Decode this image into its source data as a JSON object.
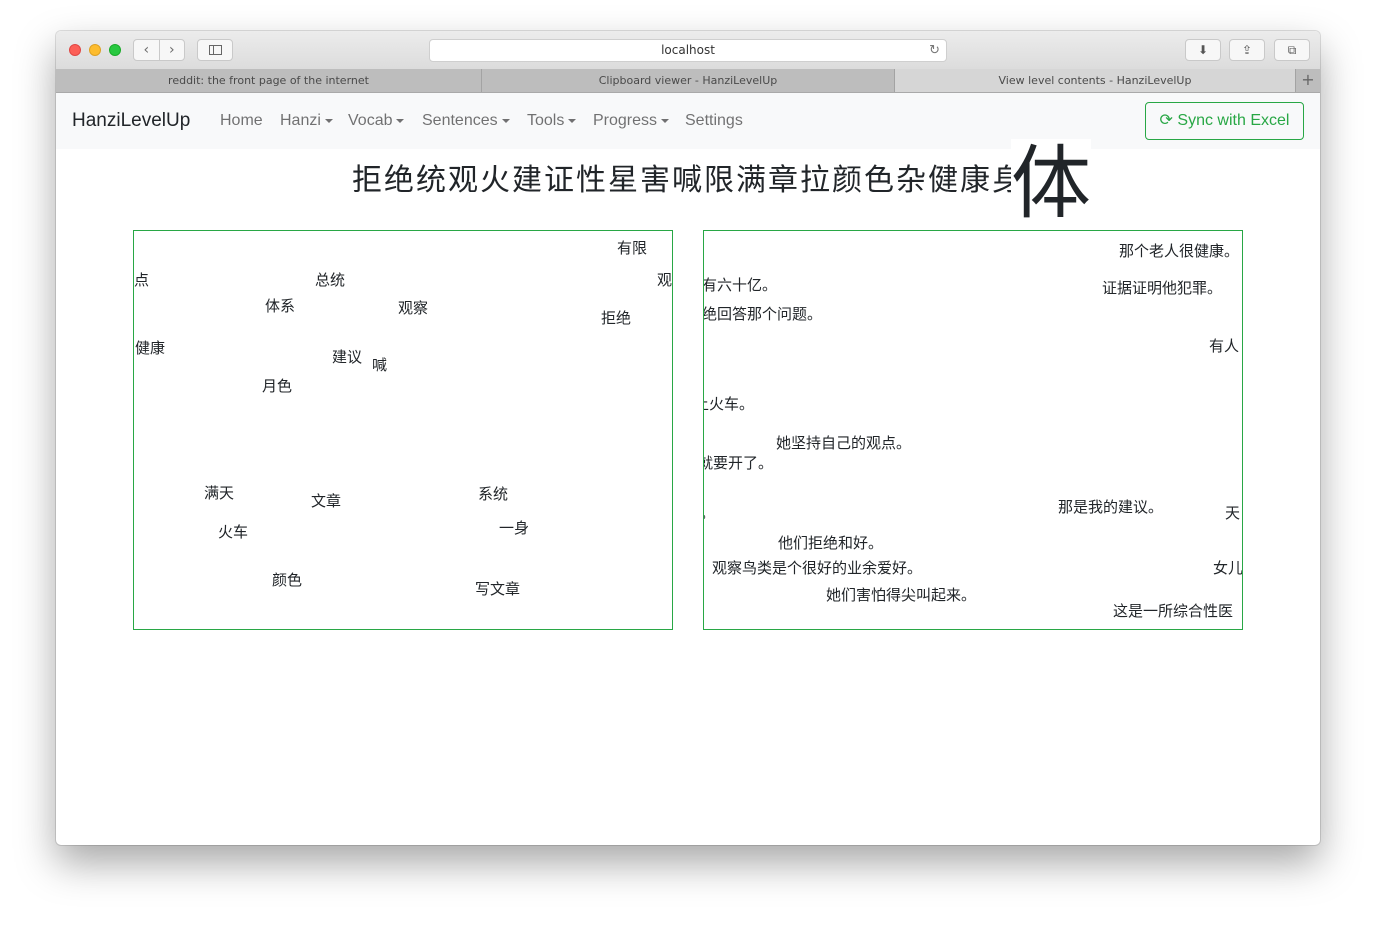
{
  "browser": {
    "url": "localhost",
    "tabs": [
      {
        "title": "reddit: the front page of the internet"
      },
      {
        "title": "Clipboard viewer - HanziLevelUp"
      },
      {
        "title": "View level contents - HanziLevelUp"
      }
    ],
    "icons": {
      "back": "‹",
      "forward": "›",
      "reload": "↻",
      "download": "⬇",
      "share": "⇪",
      "tabs": "⧉",
      "new_tab": "+"
    }
  },
  "navbar": {
    "brand": "HanziLevelUp",
    "links": [
      "Home",
      "Hanzi",
      "Vocab",
      "Sentences",
      "Tools",
      "Progress",
      "Settings"
    ],
    "sync_button": "Sync with Excel",
    "sync_icon": "⟳",
    "accent_color": "#28a745"
  },
  "main": {
    "heading": "拒绝统观火建证性星害喊限满章拉颜色杂健康身",
    "highlight_char": "体",
    "vocab_words": [
      "有限",
      "点",
      "总统",
      "观",
      "体系",
      "观察",
      "拒绝",
      "健康",
      "建议",
      "喊",
      "月色",
      "满天",
      "文章",
      "系统",
      "一身",
      "火车",
      "颜色",
      "写文章"
    ],
    "sentences": [
      "那个老人很健康。",
      "有六十亿。",
      "证据证明他犯罪。",
      "绝回答那个问题。",
      "有人",
      "上火车。",
      "她坚持自己的观点。",
      "就要开了。",
      "那是我的建议。",
      "天",
      "。",
      "他们拒绝和好。",
      "观察鸟类是个很好的业余爱好。",
      "女儿",
      "她们害怕得尖叫起来。",
      "这是一所综合性医"
    ]
  }
}
